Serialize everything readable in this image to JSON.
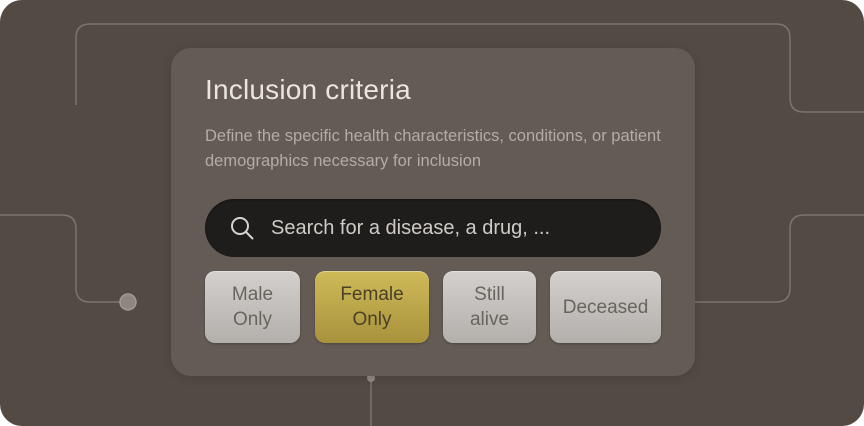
{
  "card": {
    "title": "Inclusion criteria",
    "description": "Define the specific health characteristics, conditions, or patient demographics necessary for inclusion"
  },
  "search": {
    "placeholder": "Search for a disease, a drug, ...",
    "icon": "search-icon"
  },
  "filters": [
    {
      "label": "Male\nOnly",
      "selected": false
    },
    {
      "label": "Female\nOnly",
      "selected": true
    },
    {
      "label": "Still\nalive",
      "selected": false
    },
    {
      "label": "Deceased",
      "selected": false
    }
  ],
  "colors": {
    "background": "#524a43",
    "panel": "#635b54",
    "search_bar": "#1f1d1c",
    "chip": "#c4c1be",
    "chip_selected": "#c0aa4d"
  }
}
